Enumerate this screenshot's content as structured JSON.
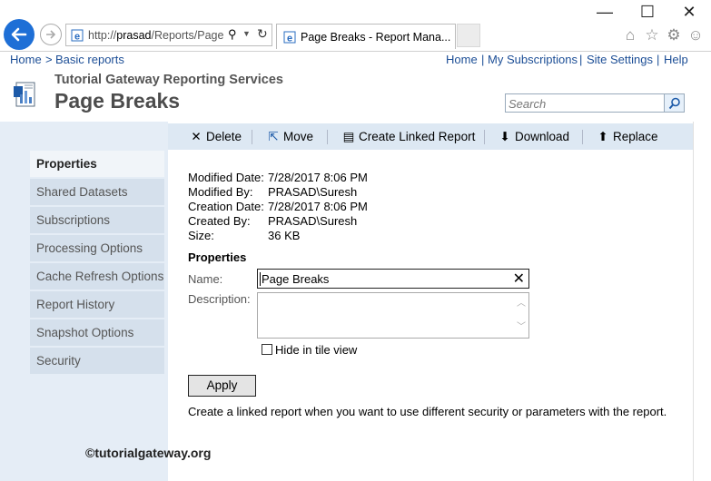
{
  "browser": {
    "url_prefix": "http://",
    "url_host": "prasad",
    "url_rest": "/Reports/Page:",
    "tab_title": "Page Breaks - Report Mana...",
    "window_buttons": [
      "—",
      "☐",
      "✕"
    ]
  },
  "topbar": {
    "home": "Home",
    "sep": ">",
    "basic_reports": "Basic reports",
    "links": [
      "Home",
      "My Subscriptions",
      "Site Settings",
      "Help"
    ]
  },
  "header": {
    "site_title": "Tutorial Gateway Reporting Services",
    "page_title": "Page Breaks",
    "search_placeholder": "Search"
  },
  "toolbar": {
    "delete": "Delete",
    "move": "Move",
    "create_linked": "Create Linked Report",
    "download": "Download",
    "replace": "Replace"
  },
  "nav": [
    "Properties",
    "Shared Datasets",
    "Subscriptions",
    "Processing Options",
    "Cache Refresh Options",
    "Report History",
    "Snapshot Options",
    "Security"
  ],
  "info": {
    "modified_date_label": "Modified Date:",
    "modified_date": "7/28/2017 8:06 PM",
    "modified_by_label": "Modified By:",
    "modified_by": "PRASAD\\Suresh",
    "creation_date_label": "Creation Date:",
    "creation_date": "7/28/2017 8:06 PM",
    "created_by_label": "Created By:",
    "created_by": "PRASAD\\Suresh",
    "size_label": "Size:",
    "size": "36 KB"
  },
  "properties": {
    "heading": "Properties",
    "name_label": "Name:",
    "name_value": "Page Breaks",
    "description_label": "Description:",
    "hide_label": "Hide in tile view",
    "apply": "Apply",
    "note": "Create a linked report when you want to use different security or parameters with the report."
  },
  "watermark": "©tutorialgateway.org",
  "colors": {
    "accent": "#1e6fd6",
    "link": "#1c4e96",
    "sidebar_bg": "#e5edf6",
    "toolbar_bg": "#dde8f3"
  }
}
